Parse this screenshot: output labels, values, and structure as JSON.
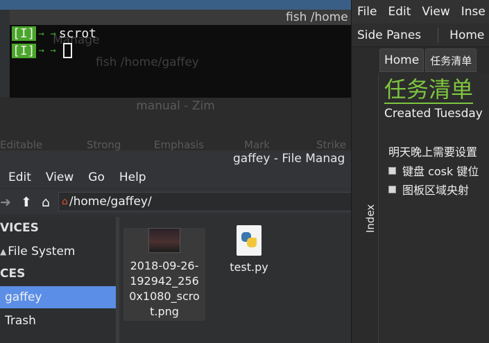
{
  "terminal": {
    "title": "fish  /home",
    "lines": [
      {
        "badge": "[I]",
        "arrows": "→ →",
        "text": "scrot"
      },
      {
        "badge": "[I]",
        "arrows": "→ →",
        "text": ""
      }
    ],
    "ghost_manager": "Manage",
    "ghost_fish": "fish  /home/gaffey"
  },
  "zim_faded": {
    "title": "manual - Zim",
    "tools": [
      "Editable",
      "Strong",
      "Emphasis",
      "Mark",
      "Strike"
    ]
  },
  "file_manager": {
    "title": "gaffey - File Manag",
    "menu": [
      "Edit",
      "View",
      "Go",
      "Help"
    ],
    "path": "/home/gaffey/",
    "sidebar": {
      "heading_devices": "VICES",
      "heading_places": "CES",
      "items": [
        {
          "label": "File System",
          "selected": false
        },
        {
          "label": "gaffey",
          "selected": true
        },
        {
          "label": "Trash",
          "selected": false
        }
      ]
    },
    "files": [
      {
        "name": "2018-09-26-192942_2560x1080_scrot.png",
        "name_lines": [
          "2018-09-26-",
          "192942_256",
          "0x1080_scro",
          "t.png"
        ],
        "type": "image"
      },
      {
        "name": "test.py",
        "name_lines": [
          "test.py"
        ],
        "type": "python"
      }
    ]
  },
  "zim": {
    "menu": [
      "File",
      "Edit",
      "View",
      "Inse"
    ],
    "toolbar": {
      "side_panes": "Side Panes",
      "home": "Home"
    },
    "sidebar_label": "Index",
    "tabs": [
      "Home",
      "任务清单"
    ],
    "page": {
      "title": "任务清单",
      "created": "Created Tuesday",
      "line1": "明天晚上需要设置",
      "checklist": [
        "键盘 cosk 键位",
        "图板区域央射"
      ]
    }
  },
  "colors": {
    "accent_green": "#7ec63f",
    "selection_blue": "#5b8ee6",
    "terminal_badge": "#4aa62a"
  }
}
